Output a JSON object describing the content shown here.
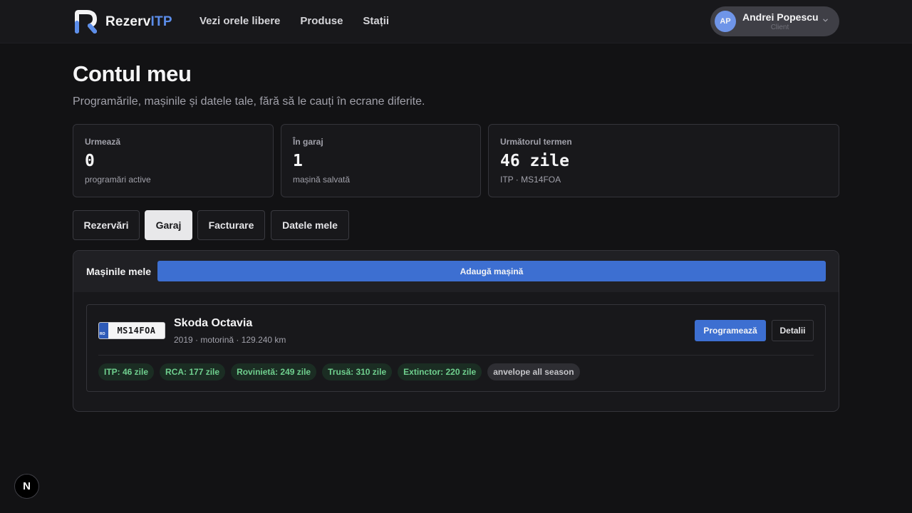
{
  "header": {
    "brand_main": "Rezerv",
    "brand_accent": "ITP",
    "nav": [
      "Vezi orele libere",
      "Produse",
      "Stații"
    ],
    "user": {
      "initials": "AP",
      "name": "Andrei Popescu",
      "role": "Client"
    }
  },
  "page": {
    "title": "Contul meu",
    "subtitle": "Programările, mașinile și datele tale, fără să le cauți în ecrane diferite."
  },
  "stats": [
    {
      "label": "Urmează",
      "value": "0",
      "desc": "programări active"
    },
    {
      "label": "În garaj",
      "value": "1",
      "desc": "mașină salvată"
    },
    {
      "label": "Următorul termen",
      "value": "46 zile",
      "desc": "ITP · MS14FOA"
    }
  ],
  "tabs": [
    "Rezervări",
    "Garaj",
    "Facturare",
    "Datele mele"
  ],
  "active_tab": "Garaj",
  "garage": {
    "title": "Mașinile mele",
    "add_button": "Adaugă mașină",
    "cars": [
      {
        "plate_country": "RO",
        "plate": "MS14FOA",
        "name": "Skoda Octavia",
        "meta": "2019 · motorină · 129.240 km",
        "schedule_button": "Programează",
        "details_button": "Detalii",
        "chips": [
          "ITP: 46 zile",
          "RCA: 177 zile",
          "Rovinietă: 249 zile",
          "Trusă: 310 zile",
          "Extinctor: 220 zile",
          "anvelope all season"
        ]
      }
    ]
  },
  "dev_badge": "N",
  "colors": {
    "accent": "#3d6fd1",
    "background": "#121214",
    "surface": "#18181b",
    "chip_green": "#6fcf8e"
  },
  "icons": {
    "logo": "brand-r-logo-icon",
    "user_menu": "chevron-down-icon",
    "dev": "nextjs-icon"
  }
}
